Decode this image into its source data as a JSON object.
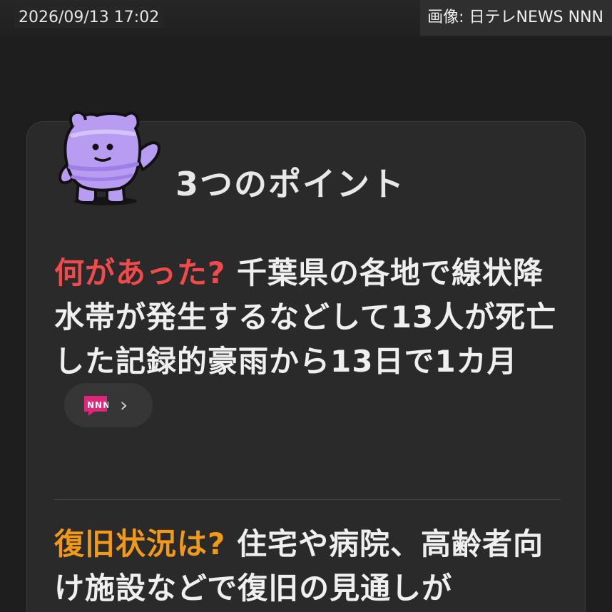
{
  "header": {
    "timestamp": "2026/09/13 17:02",
    "image_credit": "画像: 日テレNEWS NNN"
  },
  "card": {
    "title": "3つのポイント",
    "mascot_icon": "purple-bear-mascot-icon",
    "points": [
      {
        "question": "何があった?",
        "question_color": "#f04a4a",
        "answer": "千葉県の各地で線状降水帯が発生するなどして13人が死亡した記録的豪雨から13日で1カ月",
        "source_logo": "NNN",
        "source_arrow": "›"
      },
      {
        "question": "復旧状況は?",
        "question_color": "#f29a18",
        "answer": "住宅や病院、高齢者向け施設などで復旧の見通しが"
      }
    ]
  },
  "colors": {
    "background": "#1e1e1e",
    "card": "#2a2a2a",
    "mascot": "#b79cf2",
    "nnn_logo": "#e0267a"
  }
}
